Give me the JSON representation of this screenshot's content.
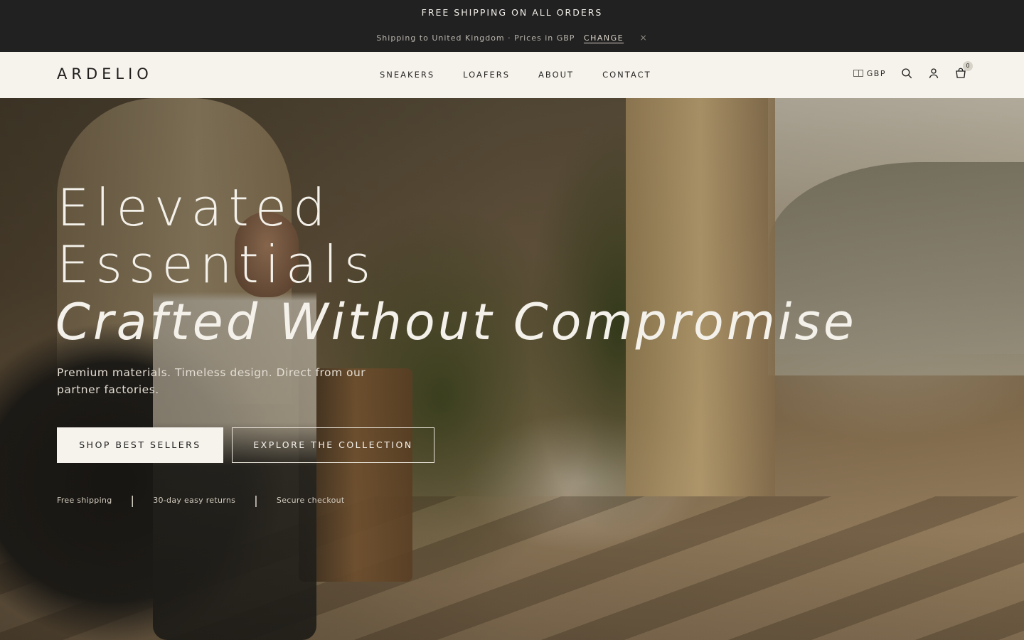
{
  "announcement": {
    "main": "FREE SHIPPING ON ALL ORDERS",
    "shipping_text": "Shipping to United Kingdom · Prices in GBP",
    "change_label": "CHANGE",
    "close_icon": "×"
  },
  "header": {
    "logo": "ARDELIO",
    "nav": [
      "SNEAKERS",
      "LOAFERS",
      "ABOUT",
      "CONTACT"
    ],
    "currency": "GBP",
    "cart_count": "0",
    "icons": [
      "flag-icon",
      "search-icon",
      "account-icon",
      "cart-icon"
    ]
  },
  "hero": {
    "line1": "Elevated",
    "line2": "Essentials",
    "line3": "Crafted Without Compromise",
    "subtitle": "Premium materials. Timeless design. Direct from our partner factories.",
    "primary_cta": "SHOP BEST SELLERS",
    "secondary_cta": "EXPLORE THE COLLECTION",
    "trust": [
      "Free shipping",
      "30-day easy returns",
      "Secure checkout"
    ]
  },
  "colors": {
    "announcement_bg": "#222121",
    "header_bg": "#f6f3ed",
    "text_dark": "#1f1e1c",
    "text_light": "#f4f1ea"
  }
}
